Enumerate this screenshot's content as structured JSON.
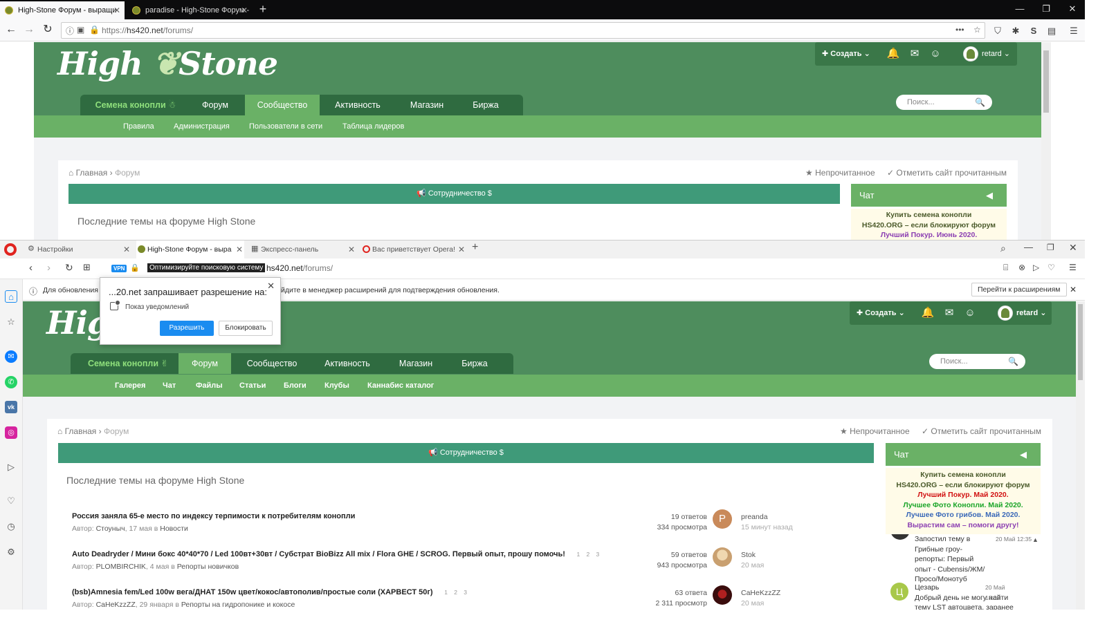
{
  "firefox": {
    "tabs": [
      {
        "label": "High-Stone Форум - выращи",
        "active": true
      },
      {
        "label": "paradise - High-Stone Форум -",
        "active": false
      }
    ],
    "url_scheme": "https://",
    "url_host": "hs420.net",
    "url_path": "/forums/",
    "user": "retard",
    "create_label": "Создать",
    "search_placeholder": "Поиск...",
    "main_nav": [
      "Семена конопли",
      "Форум",
      "Сообщество",
      "Активность",
      "Магазин",
      "Биржа"
    ],
    "main_nav_selected": "Сообщество",
    "sub_nav": [
      "Правила",
      "Администрация",
      "Пользователи в сети",
      "Таблица лидеров"
    ],
    "breadcrumb_home": "Главная",
    "breadcrumb_current": "Форум",
    "unread": "Непрочитанное",
    "mark_read": "Отметить сайт прочитанным",
    "coop_banner": "Сотрудничество $",
    "latest_title": "Последние темы на форуме High Stone",
    "chat_title": "Чат",
    "chat_lines": [
      "Купить семена конопли",
      "HS420.ORG – если блокируют форум",
      "Лучший Покур. Июнь 2020."
    ]
  },
  "opera": {
    "tabs": [
      {
        "label": "Настройки"
      },
      {
        "label": "High-Stone Форум - выра"
      },
      {
        "label": "Экспресс-панель"
      },
      {
        "label": "Вас приветствует Opera!"
      }
    ],
    "vpn": "VPN",
    "seo_tooltip": "Оптимизируйте поисковую систему",
    "url_host": "hs420.net",
    "url_path": "/forums/",
    "notice_left": "Для обновления р",
    "notice_right": "йдите в менеджер расширений для подтверждения обновления.",
    "notice_button": "Перейти к расширениям",
    "popup_title": "...20.net запрашивает разрешение на:",
    "popup_permission": "Показ уведомлений",
    "popup_allow": "Разрешить",
    "popup_block": "Блокировать",
    "user": "retard",
    "create_label": "Создать",
    "search_placeholder": "Поиск...",
    "main_nav": [
      "Семена конопли",
      "Форум",
      "Сообщество",
      "Активность",
      "Магазин",
      "Биржа"
    ],
    "main_nav_selected": "Форум",
    "sub_nav": [
      "Галерея",
      "Чат",
      "Файлы",
      "Статьи",
      "Блоги",
      "Клубы",
      "Каннабис каталог"
    ],
    "breadcrumb_home": "Главная",
    "breadcrumb_current": "Форум",
    "unread": "Непрочитанное",
    "mark_read": "Отметить сайт прочитанным",
    "coop_banner": "Сотрудничество $",
    "latest_title": "Последние темы на форуме High Stone",
    "chat_title": "Чат",
    "chat_lines": [
      {
        "text": "Купить семена конопли",
        "color": "#4a5a2a"
      },
      {
        "text": "HS420.ORG – если блокируют форум",
        "color": "#4a5a2a"
      },
      {
        "text": "Лучший Покур. Май 2020.",
        "color": "#d11111"
      },
      {
        "text": "Лучшее Фото Конопли. Май 2020.",
        "color": "#1aa528"
      },
      {
        "text": "Лучшее Фото грибов. Май 2020.",
        "color": "#3a68b8"
      },
      {
        "text": "Вырастим сам – помоги другу!",
        "color": "#8b3fb2"
      }
    ],
    "chat_messages": [
      {
        "user": "",
        "time": "20 Май 12:35",
        "text": "Запостил тему в Грибные гроу-репорты: Первый опыт - Cubensis/ЖМ/Просо/Монотуб"
      },
      {
        "user": "Цезарь",
        "time": "20 Май 18:08",
        "text": "Добрый день не могу найти тему LST автоцвета, заранее"
      }
    ],
    "threads": [
      {
        "title": "Россия заняла 65-е место по индексу терпимости к потребителям конопли",
        "pages": [],
        "author": "Стоуныч",
        "date": "17 мая",
        "in": "в",
        "forum": "Новости",
        "replies": "19 ответов",
        "views": "334 просмотра",
        "last_user": "preanda",
        "last_time": "15 минут назад",
        "avatar_letter": "P"
      },
      {
        "title": "Auto Deadryder / Мини бокс 40*40*70 / Led 100вт+30вт / Субстрат BioBizz All mix / Flora GHE / SCROG. Первый опыт, прошу помочь!",
        "pages": [
          "1",
          "2",
          "3"
        ],
        "author": "PLOMBIRCHIK",
        "date": "4 мая",
        "in": "в",
        "forum": "Репорты новичков",
        "replies": "59 ответов",
        "views": "943 просмотра",
        "last_user": "Stok",
        "last_time": "20 мая",
        "avatar_letter": ""
      },
      {
        "title": "(bsb)Amnesia fem/Led 100w вега/ДНАТ 150w цвет/кокос/автополив/простые соли (ХАРВЕСТ 50г)",
        "pages": [
          "1",
          "2",
          "3"
        ],
        "author": "CaHeKzzZZ",
        "date": "29 января",
        "in": "в",
        "forum": "Репорты на гидропонике и кокосе",
        "replies": "63 ответа",
        "views": "2 311 просмотр",
        "last_user": "CaHeKzzZZ",
        "last_time": "20 мая",
        "avatar_letter": ""
      }
    ],
    "author_prefix": "Автор:"
  }
}
